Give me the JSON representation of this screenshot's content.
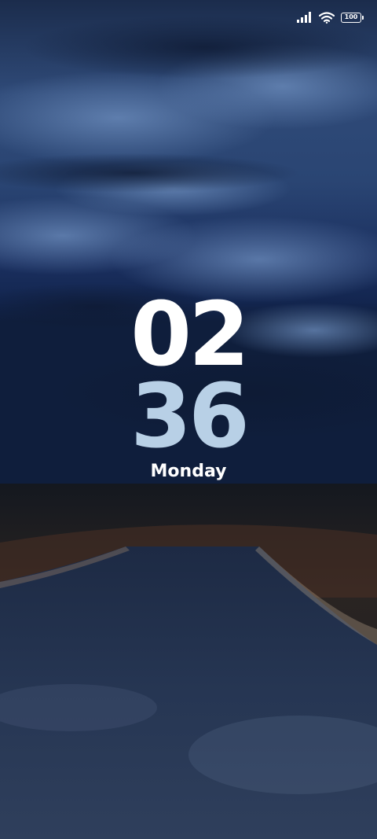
{
  "status_bar": {
    "battery_level": "100",
    "signal_icon": "signal-bars-icon",
    "wifi_icon": "wifi-icon",
    "battery_icon": "battery-icon"
  },
  "lockscreen": {
    "hours": "02",
    "minutes": "36",
    "day": "Monday",
    "hours_color": "#ffffff",
    "minutes_color": "#b8d0e6"
  }
}
